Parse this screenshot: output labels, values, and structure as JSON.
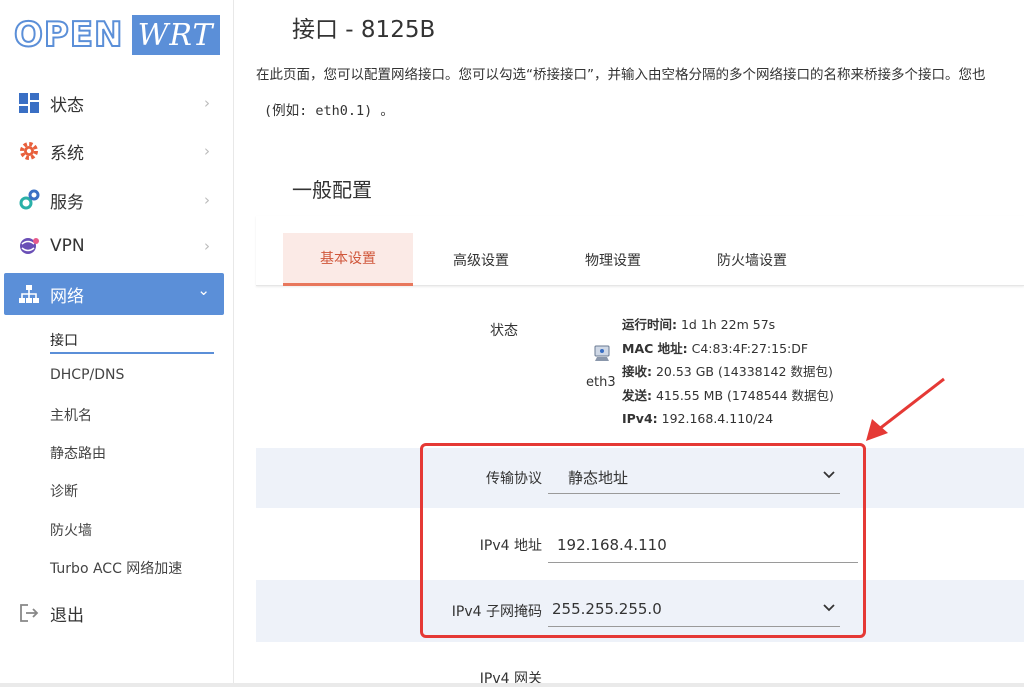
{
  "logo": {
    "part1": "OPEN",
    "part2": "WRT"
  },
  "sidebar": {
    "items": [
      {
        "label": "状态",
        "icon": "dashboard-icon"
      },
      {
        "label": "系统",
        "icon": "gear-icon"
      },
      {
        "label": "服务",
        "icon": "services-icon"
      },
      {
        "label": "VPN",
        "icon": "vpn-icon"
      },
      {
        "label": "网络",
        "icon": "network-icon"
      },
      {
        "label": "退出",
        "icon": "logout-icon"
      }
    ],
    "chevron_right": "›",
    "chevron_down": "⌄",
    "sub_items": [
      "接口",
      "DHCP/DNS",
      "主机名",
      "静态路由",
      "诊断",
      "防火墙",
      "Turbo ACC 网络加速"
    ]
  },
  "page": {
    "title": "接口 - 8125B",
    "description": "在此页面，您可以配置网络接口。您可以勾选“桥接接口”，并输入由空格分隔的多个网络接口的名称来桥接多个接口。您也",
    "description_example": "(例如: eth0.1) 。",
    "section_title": "一般配置",
    "tabs": [
      "基本设置",
      "高级设置",
      "物理设置",
      "防火墙设置"
    ]
  },
  "status": {
    "label": "状态",
    "port": "eth3",
    "lines": [
      {
        "key": "运行时间:",
        "value": " 1d 1h 22m 57s"
      },
      {
        "key": "MAC 地址:",
        "value": " C4:83:4F:27:15:DF"
      },
      {
        "key": "接收:",
        "value": " 20.53 GB (14338142 数据包)"
      },
      {
        "key": "发送:",
        "value": " 415.55 MB (1748544 数据包)"
      },
      {
        "key": "IPv4:",
        "value": " 192.168.4.110/24"
      }
    ]
  },
  "form": {
    "protocol_label": "传输协议",
    "protocol_value": "静态地址",
    "ipv4_label": "IPv4 地址",
    "ipv4_value": "192.168.4.110",
    "netmask_label": "IPv4 子网掩码",
    "netmask_value": "255.255.255.0",
    "gateway_label": "IPv4 网关"
  },
  "colors": {
    "accent": "#5b8fd8",
    "tab_active": "#d0573b",
    "annotation_red": "#e53935",
    "row_shade": "#eef2f9"
  }
}
